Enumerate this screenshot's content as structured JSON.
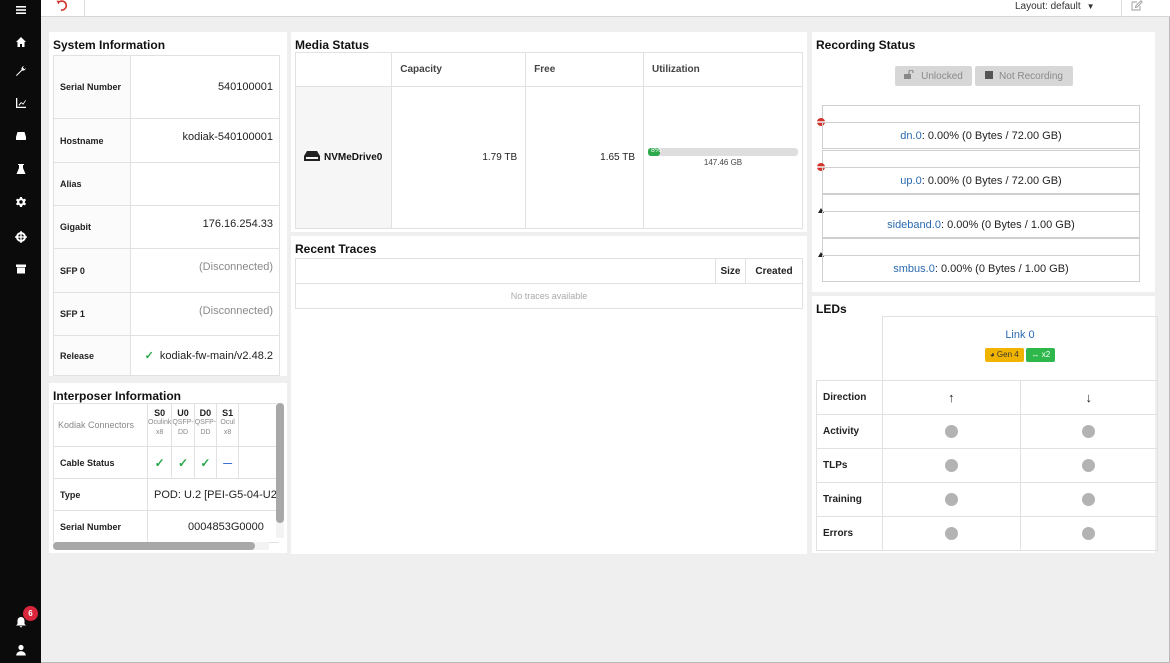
{
  "topbar": {
    "layout_label": "Layout: default"
  },
  "notifications": {
    "count": "6"
  },
  "system_info": {
    "title": "System Information",
    "rows": [
      {
        "key": "Serial Number",
        "value": "540100001"
      },
      {
        "key": "Hostname",
        "value": "kodiak-540100001"
      },
      {
        "key": "Alias",
        "value": ""
      },
      {
        "key": "Gigabit",
        "value": "176.16.254.33"
      },
      {
        "key": "SFP 0",
        "value": "(Disconnected)"
      },
      {
        "key": "SFP 1",
        "value": "(Disconnected)"
      },
      {
        "key": "Release",
        "value": "kodiak-fw-main/v2.48.2"
      }
    ]
  },
  "interposer": {
    "title": "Interposer Information",
    "connectors_label": "Kodiak Connectors",
    "connectors": [
      {
        "name": "S0",
        "sub1": "Oculink",
        "sub2": "x8"
      },
      {
        "name": "U0",
        "sub1": "QSFP-",
        "sub2": "DD"
      },
      {
        "name": "D0",
        "sub1": "QSFP-",
        "sub2": "DD"
      },
      {
        "name": "S1",
        "sub1": "Ocul",
        "sub2": "x8"
      }
    ],
    "cable_status_label": "Cable Status",
    "type_label": "Type",
    "type_value": "POD: U.2 [PEI-G5-04-U2",
    "serial_label": "Serial Number",
    "serial_value": "0004853G0000"
  },
  "media": {
    "title": "Media Status",
    "headers": {
      "capacity": "Capacity",
      "free": "Free",
      "utilization": "Utilization"
    },
    "drive": {
      "name": "NVMeDrive0",
      "capacity": "1.79 TB",
      "free": "1.65 TB",
      "util_percent": 8,
      "util_label": "8%",
      "used": "147.46 GB"
    }
  },
  "traces": {
    "title": "Recent Traces",
    "headers": {
      "size": "Size",
      "created": "Created"
    },
    "empty": "No traces available"
  },
  "recording": {
    "title": "Recording Status",
    "unlocked_label": "Unlocked",
    "not_recording_label": "Not Recording",
    "buffers": [
      {
        "name": "dn.0",
        "usage": ": 0.00% (0 Bytes / 72.00 GB)",
        "marker": "red"
      },
      {
        "name": "up.0",
        "usage": ": 0.00% (0 Bytes / 72.00 GB)",
        "marker": "red"
      },
      {
        "name": "sideband.0",
        "usage": ": 0.00% (0 Bytes / 1.00 GB)",
        "marker": "black"
      },
      {
        "name": "smbus.0",
        "usage": ": 0.00% (0 Bytes / 1.00 GB)",
        "marker": "black"
      }
    ]
  },
  "leds": {
    "title": "LEDs",
    "link_label": "Link 0",
    "gen_tag": "Gen 4",
    "width_tag": "x2",
    "gen_color": "#f0b400",
    "width_color": "#2eb84c",
    "rows": {
      "direction": "Direction",
      "activity": "Activity",
      "tlps": "TLPs",
      "training": "Training",
      "errors": "Errors"
    },
    "up_arrow": "↑",
    "down_arrow": "↓"
  }
}
